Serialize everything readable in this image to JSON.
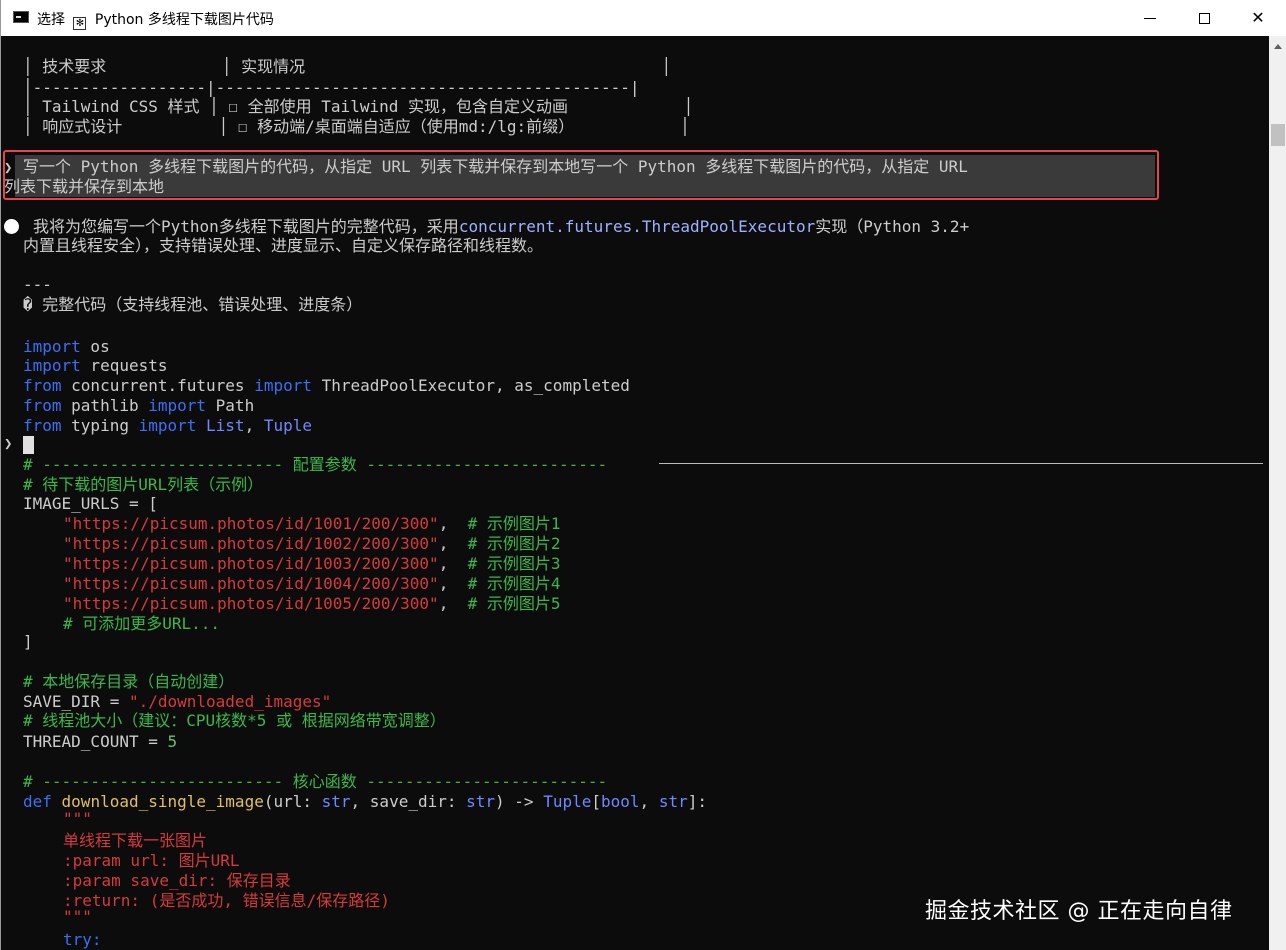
{
  "window": {
    "title_prefix": "选择",
    "title_icon_glyph": "✻",
    "title": "Python 多线程下载图片代码",
    "controls": {
      "minimize": "minimize-icon",
      "maximize": "maximize-icon",
      "close": "✕"
    }
  },
  "table": {
    "header": "│ 技术要求            │ 实现情况                                     │",
    "divider": "│------------------|-------------------------------------------|",
    "row1": "│ Tailwind CSS 样式 │ ☐ 全部使用 Tailwind 实现，包含自定义动画            │",
    "row2": "│ 响应式设计          │ ☐ 移动端/桌面端自适应（使用md:/lg:前缀）           │"
  },
  "prompt": {
    "line1": "写一个 Python 多线程下载图片的代码，从指定 URL 列表下载并保存到本地写一个 Python 多线程下载图片的代码，从指定 URL",
    "line2": "列表下载并保存到本地"
  },
  "response": {
    "line1_a": "我将为您编写一个Python多线程下载图片的完整代码，采用",
    "line1_b": "concurrent.futures.ThreadPoolExecutor",
    "line1_c": "实现（Python 3.2+",
    "line2": "内置且线程安全），支持错误处理、进度显示、自定义保存路径和线程数。",
    "separator": "---",
    "heading": "� 完整代码（支持线程池、错误处理、进度条）"
  },
  "code": {
    "import1_kw": "import",
    "import1_mod": " os",
    "import2_kw": "import",
    "import2_mod": " requests",
    "from1_kw": "from",
    "from1_mod": " concurrent.futures ",
    "from1_imp": "import",
    "from1_names": " ThreadPoolExecutor, as_completed",
    "from2_kw": "from",
    "from2_mod": " pathlib ",
    "from2_imp": "import",
    "from2_names": " Path",
    "from3_kw": "from",
    "from3_mod": " typing ",
    "from3_imp": "import",
    "from3_t1": " List",
    "from3_sep": ", ",
    "from3_t2": "Tuple",
    "cfg_header": "# ------------------------- 配置参数 -------------------------",
    "cfg_comment": "# 待下载的图片URL列表（示例）",
    "urls_open": "IMAGE_URLS = [",
    "urls": [
      {
        "url": "\"https://picsum.photos/id/1001/200/300\"",
        "comma": ",  ",
        "note": "# 示例图片1"
      },
      {
        "url": "\"https://picsum.photos/id/1002/200/300\"",
        "comma": ",  ",
        "note": "# 示例图片2"
      },
      {
        "url": "\"https://picsum.photos/id/1003/200/300\"",
        "comma": ",  ",
        "note": "# 示例图片3"
      },
      {
        "url": "\"https://picsum.photos/id/1004/200/300\"",
        "comma": ",  ",
        "note": "# 示例图片4"
      },
      {
        "url": "\"https://picsum.photos/id/1005/200/300\"",
        "comma": ",  ",
        "note": "# 示例图片5"
      }
    ],
    "urls_more": "# 可添加更多URL...",
    "urls_close": "]",
    "savedir_comment": "# 本地保存目录（自动创建）",
    "savedir_name": "SAVE_DIR = ",
    "savedir_value": "\"./downloaded_images\"",
    "thread_comment": "# 线程池大小（建议：CPU核数*5 或 根据网络带宽调整）",
    "thread_name": "THREAD_COUNT = ",
    "thread_value": "5",
    "core_header": "# ------------------------- 核心函数 -------------------------",
    "def_kw": "def",
    "def_name": " download_single_image",
    "def_args_a": "(url: ",
    "def_str1": "str",
    "def_args_b": ", save_dir: ",
    "def_str2": "str",
    "def_args_c": ") -> ",
    "def_ret_tuple": "Tuple",
    "def_ret_open": "[",
    "def_ret_bool": "bool",
    "def_ret_sep": ", ",
    "def_ret_str": "str",
    "def_ret_close": "]:",
    "doc_open": "\"\"\"",
    "doc1": "单线程下载一张图片",
    "doc2": ":param url: 图片URL",
    "doc3": ":param save_dir: 保存目录",
    "doc4": ":return: (是否成功, 错误信息/保存路径)",
    "doc_close": "\"\"\"",
    "try_kw": "try:"
  },
  "watermark": "掘金技术社区 @ 正在走向自律",
  "colors": {
    "keyword": "#3b6ff4",
    "string": "#d63a3a",
    "comment": "#3ab84a",
    "highlight_border": "#e3474a"
  }
}
